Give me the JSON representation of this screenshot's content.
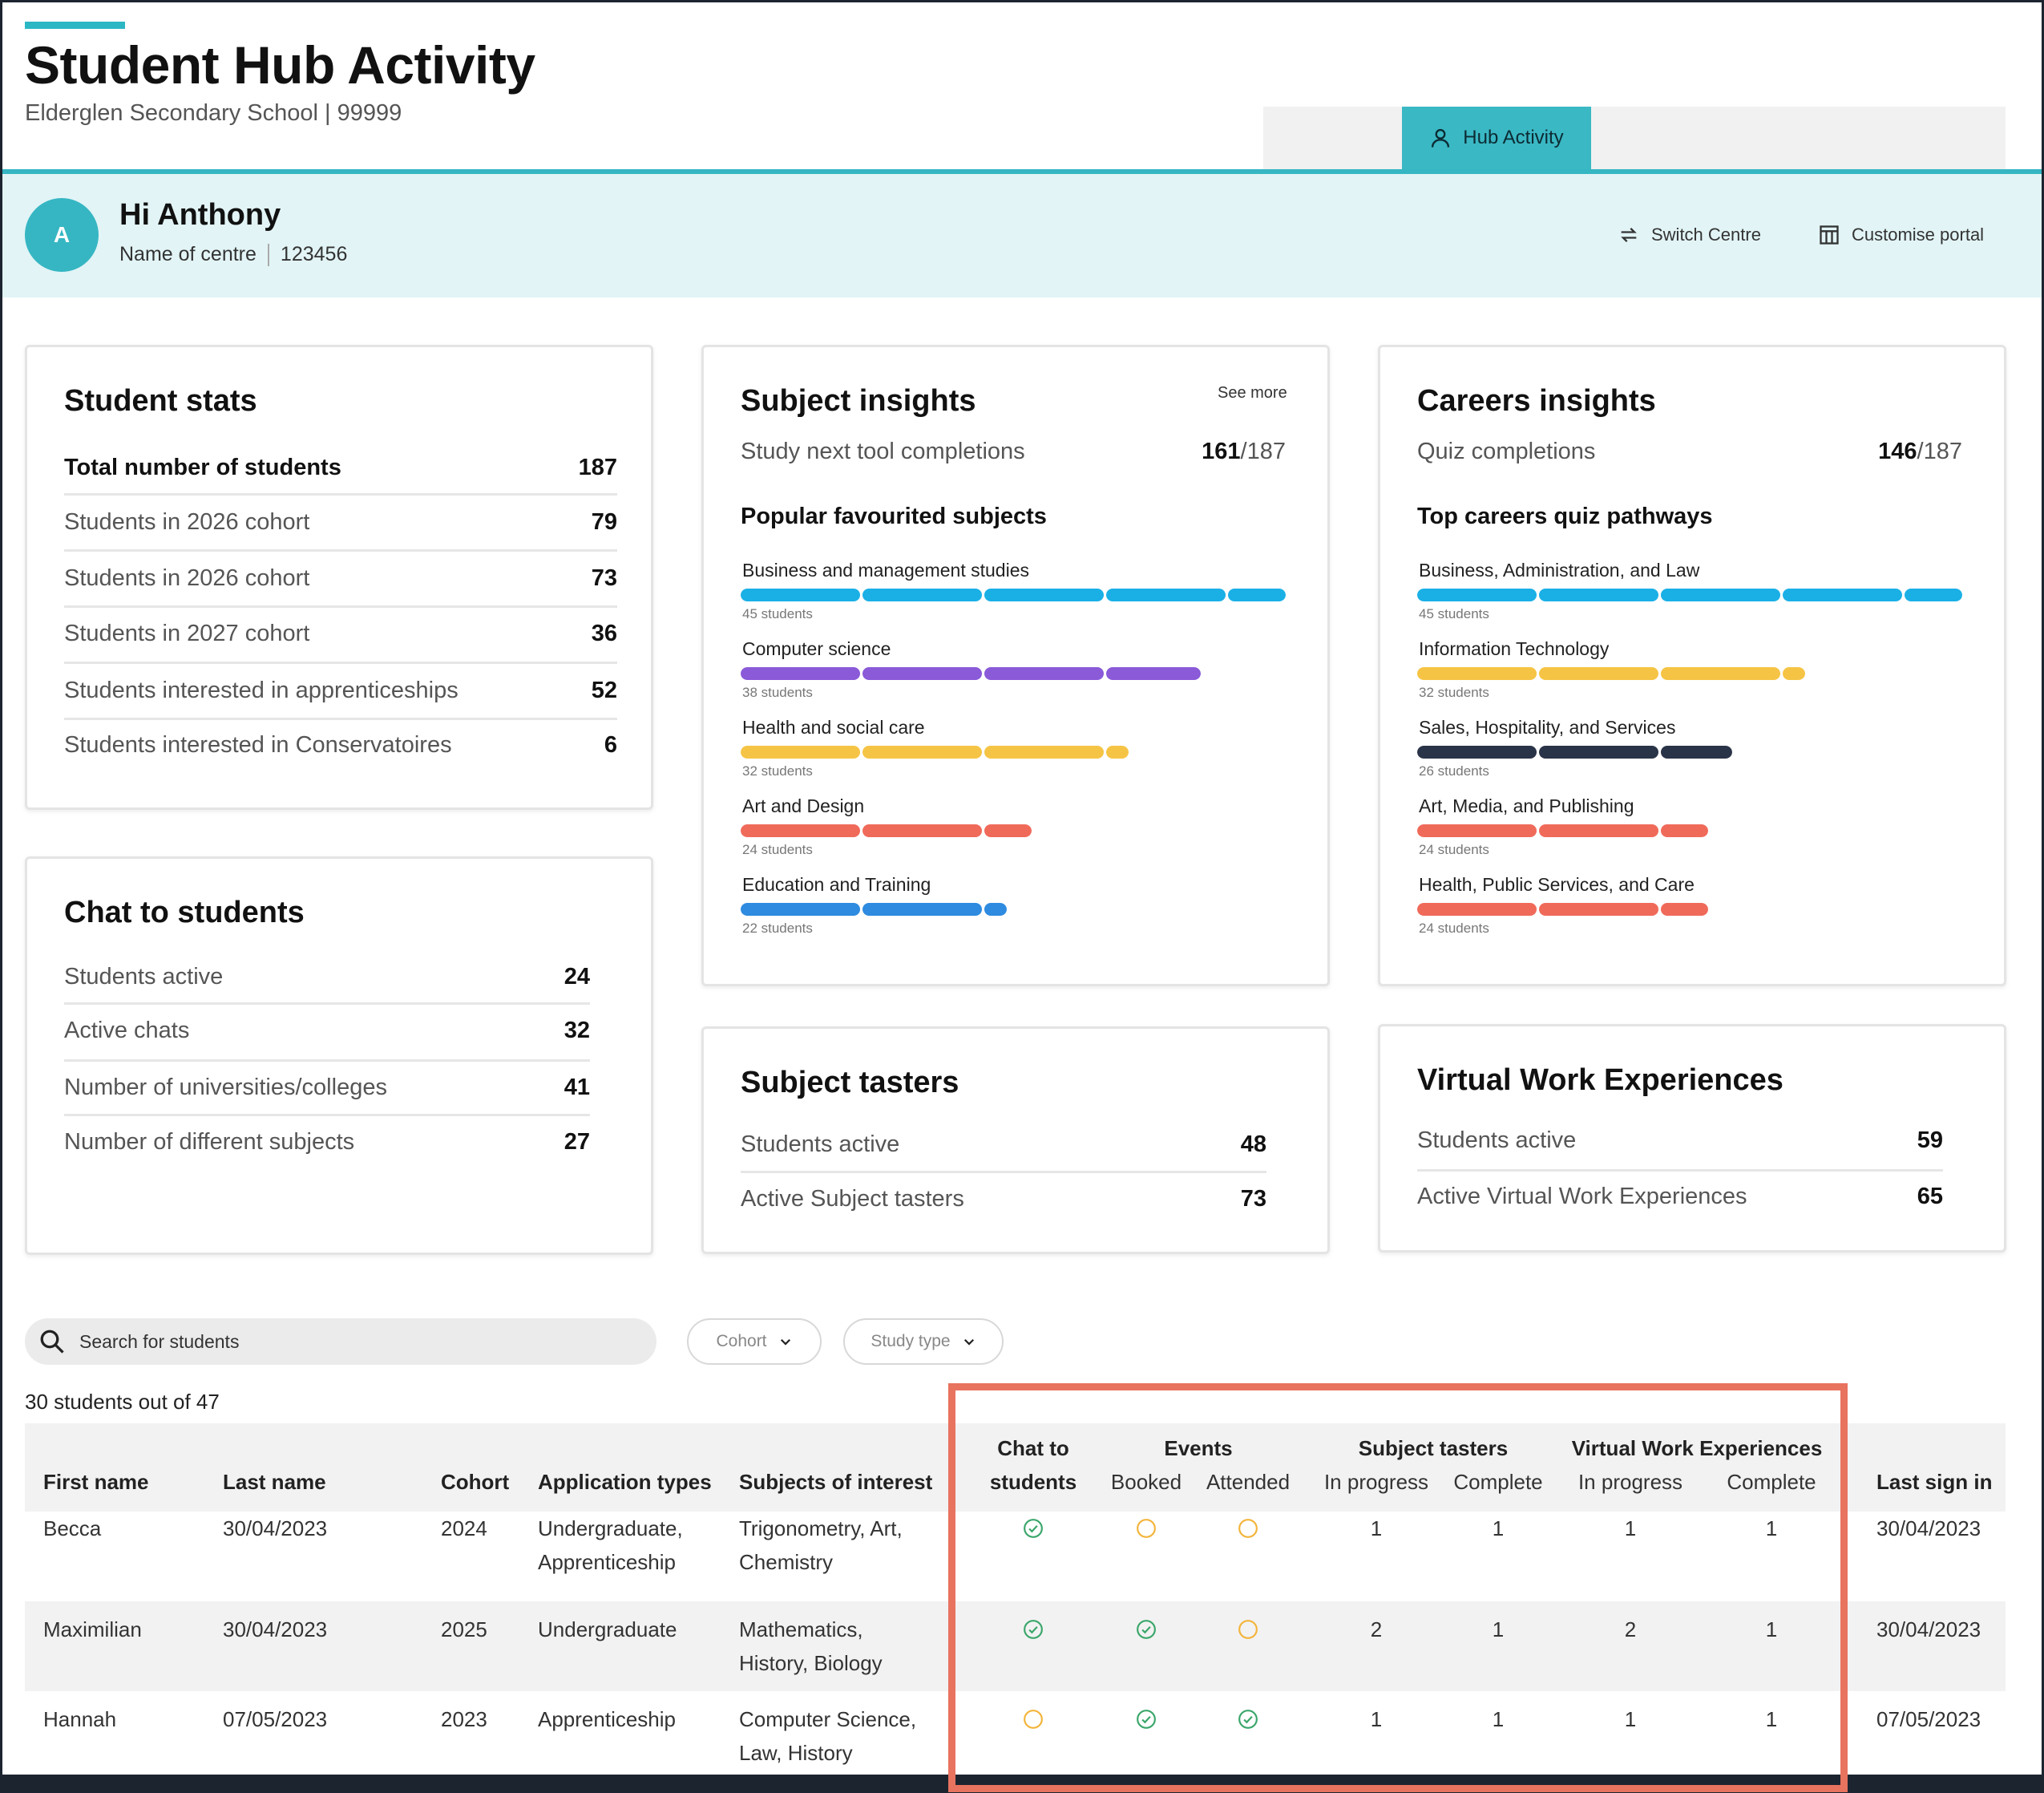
{
  "header": {
    "title": "Student Hub Activity",
    "subtitle": "Elderglen Secondary School | 99999",
    "active_tab": "Hub Activity",
    "active_tab_icon": "person-icon"
  },
  "greeting": {
    "avatar_initial": "A",
    "title": "Hi Anthony",
    "centre_name": "Name of centre",
    "centre_number": "123456",
    "switch_centre": "Switch Centre",
    "customise_portal": "Customise portal"
  },
  "student_stats": {
    "title": "Student stats",
    "rows": [
      {
        "label": "Total number of students",
        "value": "187"
      },
      {
        "label": "Students in 2026 cohort",
        "value": "79"
      },
      {
        "label": "Students in 2026 cohort",
        "value": "73"
      },
      {
        "label": "Students in 2027 cohort",
        "value": "36"
      },
      {
        "label": "Students interested in apprenticeships",
        "value": "52"
      },
      {
        "label": "Students interested in Conservatoires",
        "value": "6"
      }
    ]
  },
  "chat": {
    "title": "Chat to students",
    "rows": [
      {
        "label": "Students active",
        "value": "24"
      },
      {
        "label": "Active chats",
        "value": "32"
      },
      {
        "label": "Number of universities/colleges",
        "value": "41"
      },
      {
        "label": "Number of different subjects",
        "value": "27"
      }
    ]
  },
  "subject_insights": {
    "title": "Subject insights",
    "see_more": "See more",
    "completions_label": "Study next tool completions",
    "completions_value": "161",
    "completions_total": "/187",
    "section_title": "Popular favourited subjects",
    "max_students": 45,
    "bars": [
      {
        "label": "Business and management studies",
        "students": 45,
        "count_text": "45 students",
        "color": "#1ab0e6"
      },
      {
        "label": "Computer science",
        "students": 38,
        "count_text": "38 students",
        "color": "#8a5ad8"
      },
      {
        "label": "Health and social care",
        "students": 32,
        "count_text": "32 students",
        "color": "#f6c445"
      },
      {
        "label": "Art and Design",
        "students": 24,
        "count_text": "24 students",
        "color": "#f06a5a"
      },
      {
        "label": "Education and Training",
        "students": 22,
        "count_text": "22 students",
        "color": "#2e8be0"
      }
    ]
  },
  "careers_insights": {
    "title": "Careers insights",
    "completions_label": "Quiz completions",
    "completions_value": "146",
    "completions_total": "/187",
    "section_title": "Top careers quiz pathways",
    "max_students": 45,
    "bars": [
      {
        "label": "Business, Administration, and Law",
        "students": 45,
        "count_text": "45 students",
        "color": "#1ab0e6"
      },
      {
        "label": "Information Technology",
        "students": 32,
        "count_text": "32 students",
        "color": "#f6c445"
      },
      {
        "label": "Sales, Hospitality, and Services",
        "students": 26,
        "count_text": "26 students",
        "color": "#2a3448"
      },
      {
        "label": "Art, Media, and Publishing",
        "students": 24,
        "count_text": "24 students",
        "color": "#f06a5a"
      },
      {
        "label": "Health, Public Services, and Care",
        "students": 24,
        "count_text": "24 students",
        "color": "#f06a5a"
      }
    ]
  },
  "subject_tasters": {
    "title": "Subject tasters",
    "rows": [
      {
        "label": "Students active",
        "value": "48"
      },
      {
        "label": "Active Subject tasters",
        "value": "73"
      }
    ]
  },
  "vwe": {
    "title": "Virtual Work Experiences",
    "rows": [
      {
        "label": "Students active",
        "value": "59"
      },
      {
        "label": "Active Virtual Work Experiences",
        "value": "65"
      }
    ]
  },
  "filters": {
    "search_placeholder": "Search for students",
    "cohort": "Cohort",
    "study_type": "Study type",
    "count_text": "30 students out of 47"
  },
  "table": {
    "headers": {
      "first_name": "First name",
      "last_name": "Last name",
      "cohort": "Cohort",
      "application_types": "Application types",
      "subjects_of_interest": "Subjects of interest",
      "chat_line1": "Chat to",
      "chat_line2": "students",
      "events": "Events",
      "booked": "Booked",
      "attended": "Attended",
      "subject_tasters": "Subject tasters",
      "st_in_progress": "In progress",
      "st_complete": "Complete",
      "vwe": "Virtual Work Experiences",
      "vwe_in_progress": "In progress",
      "vwe_complete": "Complete",
      "last_sign_in": "Last sign in"
    },
    "status_colors": {
      "done": "#3aa66a",
      "pending": "#f3b43a"
    },
    "rows": [
      {
        "first": "Becca",
        "last": "30/04/2023",
        "cohort": "2024",
        "app1": "Undergraduate,",
        "app2": "Apprenticeship",
        "subj1": "Trigonometry, Art,",
        "subj2": "Chemistry",
        "chat": "done",
        "booked": "pending",
        "attended": "pending",
        "st_prog": "1",
        "st_comp": "1",
        "vwe_prog": "1",
        "vwe_comp": "1"
      },
      {
        "first": "Maximilian",
        "last": "30/04/2023",
        "cohort": "2025",
        "app1": "Undergraduate",
        "app2": "",
        "subj1": "Mathematics,",
        "subj2": "History, Biology",
        "chat": "done",
        "booked": "done",
        "attended": "pending",
        "st_prog": "2",
        "st_comp": "1",
        "vwe_prog": "2",
        "vwe_comp": "1"
      },
      {
        "first": "Hannah",
        "last": "07/05/2023",
        "cohort": "2023",
        "app1": "Apprenticeship",
        "app2": "",
        "subj1": "Computer Science,",
        "subj2": "Law, History",
        "chat": "pending",
        "booked": "done",
        "attended": "done",
        "st_prog": "1",
        "st_comp": "1",
        "vwe_prog": "1",
        "vwe_comp": "1"
      }
    ]
  }
}
